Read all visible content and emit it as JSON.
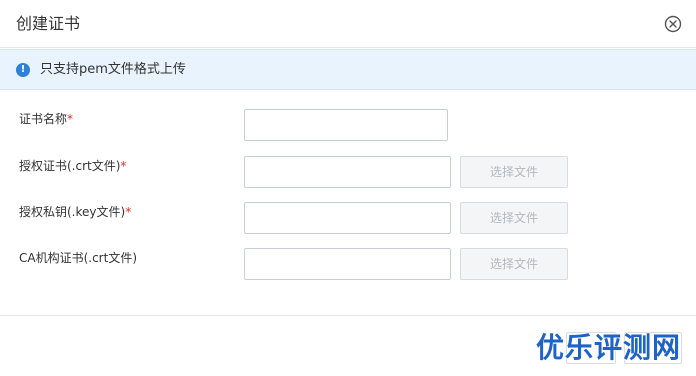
{
  "dialog": {
    "title": "创建证书"
  },
  "notice": {
    "text": "只支持pem文件格式上传",
    "icon": "info-icon",
    "icon_glyph": "!"
  },
  "form": {
    "name_label": "证书名称",
    "cert_label": "授权证书(.crt文件)",
    "key_label": "授权私钥(.key文件)",
    "ca_label": "CA机构证书(.crt文件)",
    "required_mark": "*",
    "choose_file_label": "选择文件",
    "name_value": "",
    "cert_value": "",
    "key_value": "",
    "ca_value": ""
  },
  "watermark": {
    "text": "优乐评测网"
  },
  "colors": {
    "notice_bg": "#e9f3fd",
    "info_icon": "#2f80d8",
    "required": "#e22c2c",
    "watermark": "#1e63c8"
  }
}
